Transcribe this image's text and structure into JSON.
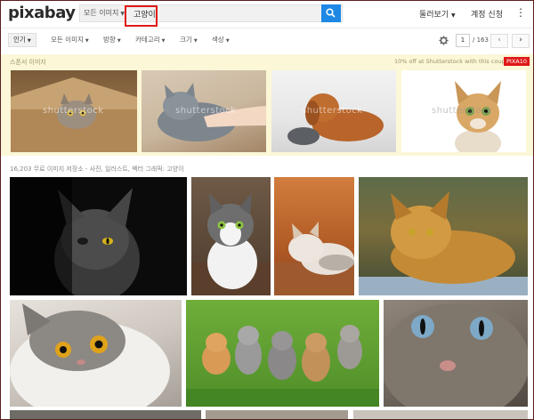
{
  "header": {
    "logo": "pixabay",
    "search_type": "모든 이미지",
    "search_query": "고양이",
    "browse_label": "둘러보기",
    "join_label": "계정 신청",
    "more_label": "⋮"
  },
  "filters": {
    "sort": "인기",
    "items": [
      "모든 이미지",
      "방향",
      "카테고리",
      "크기",
      "색상"
    ],
    "page_current": "1",
    "page_total": "/ 163",
    "prev": "‹",
    "next": "›"
  },
  "sponsored": {
    "label": "스폰서 이미지",
    "promo": "10% off at Shutterstock with this coupon",
    "code": "PIXA10",
    "watermark": "shutterstock"
  },
  "results": {
    "summary": "16,203 무료 이미지 저장소 - 사진, 일러스트, 벡터 그래픽: 고양이"
  },
  "colors": {
    "accent": "#1e88e5",
    "highlight": "#e01818",
    "sponsor_bg": "#fbf7d7"
  }
}
